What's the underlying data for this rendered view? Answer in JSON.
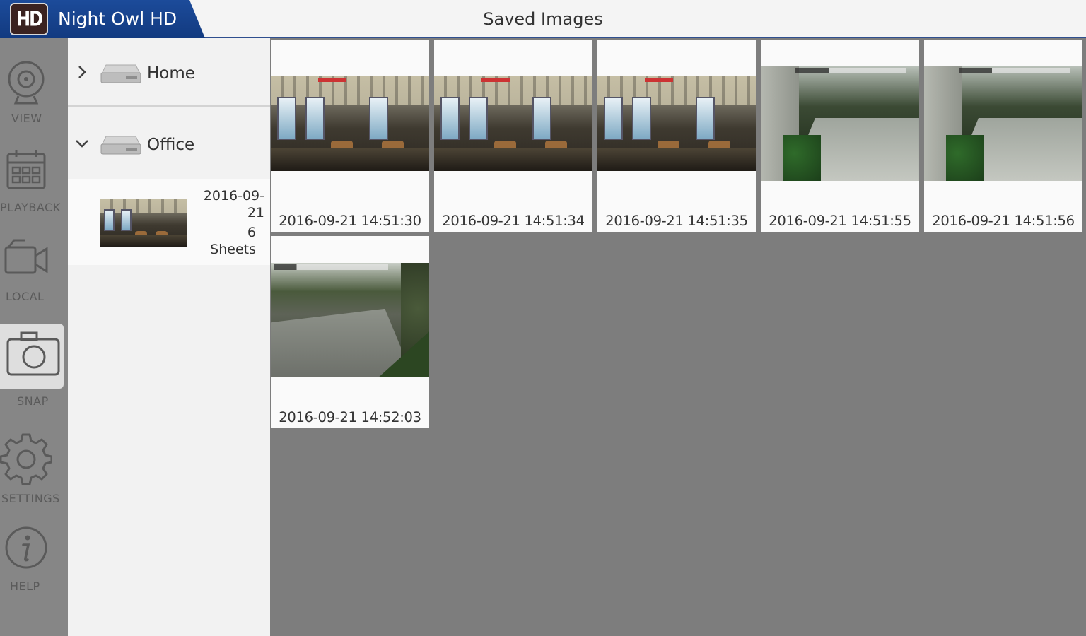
{
  "app": {
    "logo_text": "HD",
    "name": "Night Owl HD",
    "screen_title": "Saved Images"
  },
  "nav": {
    "view": "VIEW",
    "playback": "PLAYBACK",
    "local": "LOCAL",
    "snap": "SNAP",
    "settings": "SETTINGS",
    "help": "HELP",
    "active": "snap"
  },
  "devices": [
    {
      "name": "Home",
      "expanded": false
    },
    {
      "name": "Office",
      "expanded": true
    }
  ],
  "date_group": {
    "date": "2016-09-21",
    "count": "6",
    "unit": "Sheets"
  },
  "images": [
    {
      "caption": "2016-09-21  14:51:30",
      "scene": "office"
    },
    {
      "caption": "2016-09-21  14:51:34",
      "scene": "office"
    },
    {
      "caption": "2016-09-21  14:51:35",
      "scene": "office"
    },
    {
      "caption": "2016-09-21  14:51:55",
      "scene": "driveway"
    },
    {
      "caption": "2016-09-21  14:51:56",
      "scene": "driveway"
    },
    {
      "caption": "2016-09-21  14:52:03",
      "scene": "parking"
    }
  ],
  "colors": {
    "brand_blue": "#1c4b9a",
    "rail_gray": "#868686",
    "grid_gray": "#7d7d7d"
  }
}
